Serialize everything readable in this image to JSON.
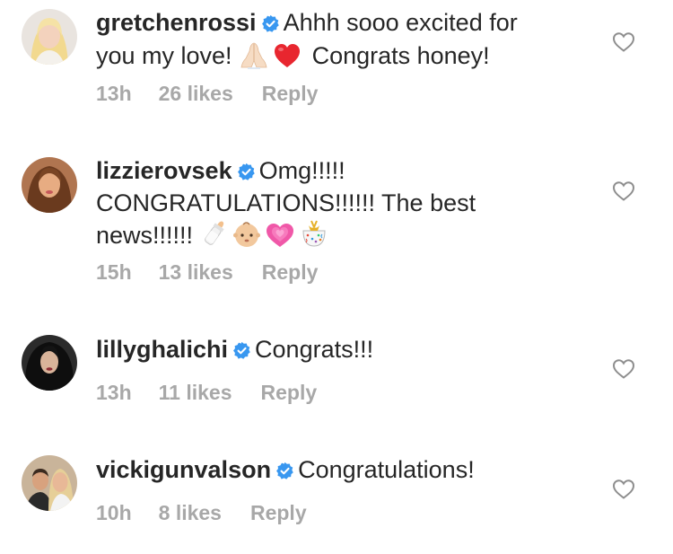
{
  "comments": [
    {
      "username": "gretchenrossi",
      "text_parts": [
        "Ahhh sooo excited for you my love! ",
        " Congrats honey!"
      ],
      "emojis": [
        "folded-hands-emoji",
        "red-heart-emoji"
      ],
      "time": "13h",
      "likes": "26 likes",
      "reply": "Reply"
    },
    {
      "username": "lizzierovsek",
      "text_parts": [
        "Omg!!!!! CONGRATULATIONS!!!!!! The best news!!!!!! "
      ],
      "emojis": [
        "baby-bottle-emoji",
        "baby-emoji",
        "growing-heart-emoji",
        "confetti-ball-emoji"
      ],
      "time": "15h",
      "likes": "13 likes",
      "reply": "Reply"
    },
    {
      "username": "lillyghalichi",
      "text_parts": [
        "Congrats!!!"
      ],
      "emojis": [],
      "time": "13h",
      "likes": "11 likes",
      "reply": "Reply"
    },
    {
      "username": "vickigunvalson",
      "text_parts": [
        "Congratulations!"
      ],
      "emojis": [],
      "time": "10h",
      "likes": "8 likes",
      "reply": "Reply"
    }
  ],
  "colors": {
    "text": "#262626",
    "meta": "#a8a8a8",
    "verified": "#3897f0",
    "heart_outline": "#8e8e8e"
  }
}
